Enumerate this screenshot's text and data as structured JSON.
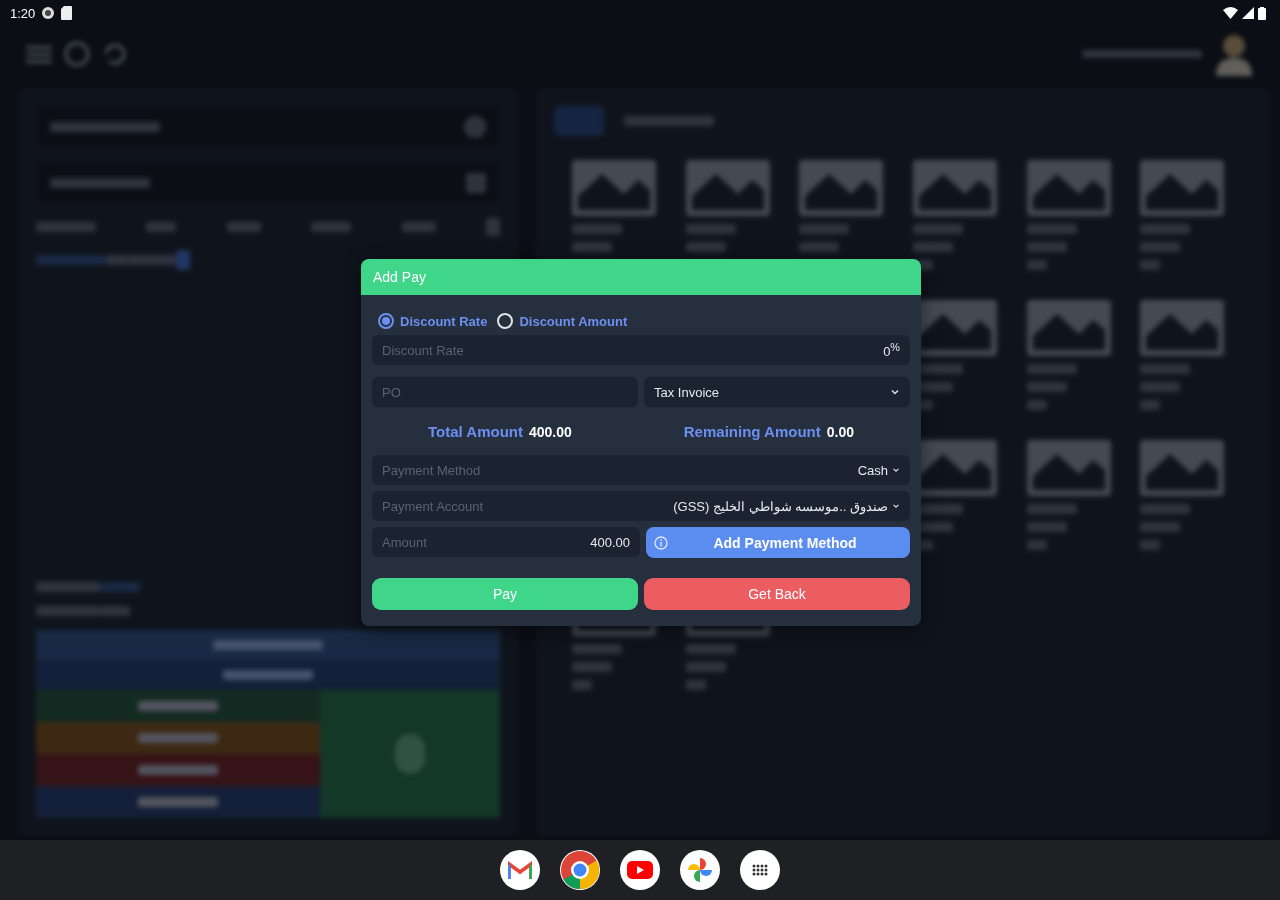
{
  "status_bar": {
    "time": "1:20"
  },
  "dialog": {
    "title": "Add Pay",
    "discount_modes": [
      {
        "label": "Discount Rate",
        "selected": true
      },
      {
        "label": "Discount Amount",
        "selected": false
      }
    ],
    "discount_field": {
      "placeholder": "Discount Rate",
      "value": "0",
      "suffix": "%"
    },
    "po_field": {
      "placeholder": "PO"
    },
    "invoice_type": {
      "value": "Tax Invoice"
    },
    "totals": [
      {
        "label": "Total Amount",
        "value": "400.00"
      },
      {
        "label": "Remaining Amount",
        "value": "0.00"
      }
    ],
    "payment_method": {
      "placeholder": "Payment Method",
      "value": "Cash"
    },
    "payment_account": {
      "placeholder": "Payment Account",
      "value": "صندوق ..موسسه شواطي الخليج (GSS)"
    },
    "amount_field": {
      "placeholder": "Amount",
      "value": "400.00"
    },
    "add_method_button": "Add Payment Method",
    "buttons": [
      {
        "label": "Pay",
        "kind": "confirm"
      },
      {
        "label": "Get Back",
        "kind": "cancel"
      }
    ]
  }
}
